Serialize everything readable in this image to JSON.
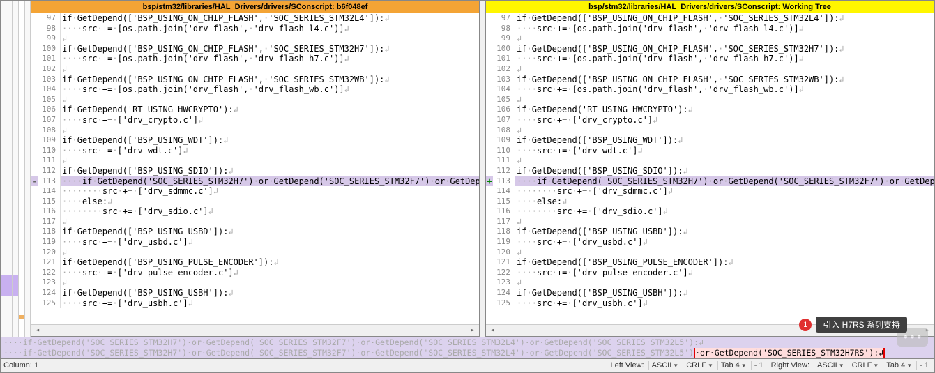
{
  "left_panel": {
    "title": "bsp/stm32/libraries/HAL_Drivers/drivers/SConscript: b6f048ef",
    "lines": [
      {
        "n": 97,
        "t": "if·GetDepend(['BSP_USING_ON_CHIP_FLASH',·'SOC_SERIES_STM32L4']):↲"
      },
      {
        "n": 98,
        "t": "····src·+=·[os.path.join('drv_flash',·'drv_flash_l4.c')]↲"
      },
      {
        "n": 99,
        "t": "↲"
      },
      {
        "n": 100,
        "t": "if·GetDepend(['BSP_USING_ON_CHIP_FLASH',·'SOC_SERIES_STM32H7']):↲"
      },
      {
        "n": 101,
        "t": "····src·+=·[os.path.join('drv_flash',·'drv_flash_h7.c')]↲"
      },
      {
        "n": 102,
        "t": "↲"
      },
      {
        "n": 103,
        "t": "if·GetDepend(['BSP_USING_ON_CHIP_FLASH',·'SOC_SERIES_STM32WB']):↲"
      },
      {
        "n": 104,
        "t": "····src·+=·[os.path.join('drv_flash',·'drv_flash_wb.c')]↲"
      },
      {
        "n": 105,
        "t": "↲"
      },
      {
        "n": 106,
        "t": "if·GetDepend('RT_USING_HWCRYPTO'):↲"
      },
      {
        "n": 107,
        "t": "····src·+=·['drv_crypto.c']↲"
      },
      {
        "n": 108,
        "t": "↲"
      },
      {
        "n": 109,
        "t": "if·GetDepend(['BSP_USING_WDT']):↲"
      },
      {
        "n": 110,
        "t": "····src·+=·['drv_wdt.c']↲"
      },
      {
        "n": 111,
        "t": "↲"
      },
      {
        "n": 112,
        "t": "if·GetDepend(['BSP_USING_SDIO']):↲"
      },
      {
        "n": 113,
        "t": "····if·GetDepend('SOC_SERIES_STM32H7')·or·GetDepend('SOC_SERIES_STM32F7')·or·GetDepe",
        "hl": true,
        "marker": "-"
      },
      {
        "n": 114,
        "t": "········src·+=·['drv_sdmmc.c']↲"
      },
      {
        "n": 115,
        "t": "····else:↲"
      },
      {
        "n": 116,
        "t": "········src·+=·['drv_sdio.c']↲"
      },
      {
        "n": 117,
        "t": "↲"
      },
      {
        "n": 118,
        "t": "if·GetDepend(['BSP_USING_USBD']):↲"
      },
      {
        "n": 119,
        "t": "····src·+=·['drv_usbd.c']↲"
      },
      {
        "n": 120,
        "t": "↲"
      },
      {
        "n": 121,
        "t": "if·GetDepend(['BSP_USING_PULSE_ENCODER']):↲"
      },
      {
        "n": 122,
        "t": "····src·+=·['drv_pulse_encoder.c']↲"
      },
      {
        "n": 123,
        "t": "↲"
      },
      {
        "n": 124,
        "t": "if·GetDepend(['BSP_USING_USBH']):↲"
      },
      {
        "n": 125,
        "t": "····src·+=·['drv_usbh.c']↲"
      }
    ]
  },
  "right_panel": {
    "title": "bsp/stm32/libraries/HAL_Drivers/drivers/SConscript: Working Tree",
    "lines": [
      {
        "n": 97,
        "t": "if·GetDepend(['BSP_USING_ON_CHIP_FLASH',·'SOC_SERIES_STM32L4']):↲"
      },
      {
        "n": 98,
        "t": "····src·+=·[os.path.join('drv_flash',·'drv_flash_l4.c')]↲"
      },
      {
        "n": 99,
        "t": "↲"
      },
      {
        "n": 100,
        "t": "if·GetDepend(['BSP_USING_ON_CHIP_FLASH',·'SOC_SERIES_STM32H7']):↲"
      },
      {
        "n": 101,
        "t": "····src·+=·[os.path.join('drv_flash',·'drv_flash_h7.c')]↲"
      },
      {
        "n": 102,
        "t": "↲"
      },
      {
        "n": 103,
        "t": "if·GetDepend(['BSP_USING_ON_CHIP_FLASH',·'SOC_SERIES_STM32WB']):↲"
      },
      {
        "n": 104,
        "t": "····src·+=·[os.path.join('drv_flash',·'drv_flash_wb.c')]↲"
      },
      {
        "n": 105,
        "t": "↲"
      },
      {
        "n": 106,
        "t": "if·GetDepend('RT_USING_HWCRYPTO'):↲"
      },
      {
        "n": 107,
        "t": "····src·+=·['drv_crypto.c']↲"
      },
      {
        "n": 108,
        "t": "↲"
      },
      {
        "n": 109,
        "t": "if·GetDepend(['BSP_USING_WDT']):↲"
      },
      {
        "n": 110,
        "t": "····src·+=·['drv_wdt.c']↲"
      },
      {
        "n": 111,
        "t": "↲"
      },
      {
        "n": 112,
        "t": "if·GetDepend(['BSP_USING_SDIO']):↲"
      },
      {
        "n": 113,
        "t": "····if·GetDepend('SOC_SERIES_STM32H7')·or·GetDepend('SOC_SERIES_STM32F7')·or·GetDepe",
        "hl": true,
        "marker": "+"
      },
      {
        "n": 114,
        "t": "········src·+=·['drv_sdmmc.c']↲"
      },
      {
        "n": 115,
        "t": "····else:↲"
      },
      {
        "n": 116,
        "t": "········src·+=·['drv_sdio.c']↲"
      },
      {
        "n": 117,
        "t": "↲"
      },
      {
        "n": 118,
        "t": "if·GetDepend(['BSP_USING_USBD']):↲"
      },
      {
        "n": 119,
        "t": "····src·+=·['drv_usbd.c']↲"
      },
      {
        "n": 120,
        "t": "↲"
      },
      {
        "n": 121,
        "t": "if·GetDepend(['BSP_USING_PULSE_ENCODER']):↲"
      },
      {
        "n": 122,
        "t": "····src·+=·['drv_pulse_encoder.c']↲"
      },
      {
        "n": 123,
        "t": "↲"
      },
      {
        "n": 124,
        "t": "if·GetDepend(['BSP_USING_USBH']):↲"
      },
      {
        "n": 125,
        "t": "····src·+=·['drv_usbh.c']↲"
      }
    ]
  },
  "bottom_diff": {
    "line1": "····if·GetDepend('SOC_SERIES_STM32H7')·or·GetDepend('SOC_SERIES_STM32F7')·or·GetDepend('SOC_SERIES_STM32L4')·or·GetDepend('SOC_SERIES_STM32L5'):↲",
    "line2_a": "····if·GetDepend('SOC_SERIES_STM32H7')·or·GetDepend('SOC_SERIES_STM32F7')·or·GetDepend('SOC_SERIES_STM32L4')·or·GetDepend('SOC_SERIES_STM32L5')",
    "line2_b": "·or·GetDepend('SOC_SERIES_STM32H7RS'):↲"
  },
  "status": {
    "column_label": "Column: 1",
    "left_view_label": "Left View:",
    "right_view_label": "Right View:",
    "encoding": "ASCII",
    "line_ending": "CRLF",
    "tab": "Tab 4",
    "offset": "- 1"
  },
  "badge": {
    "num": "1",
    "text": "引入 H7RS 系列支持"
  }
}
